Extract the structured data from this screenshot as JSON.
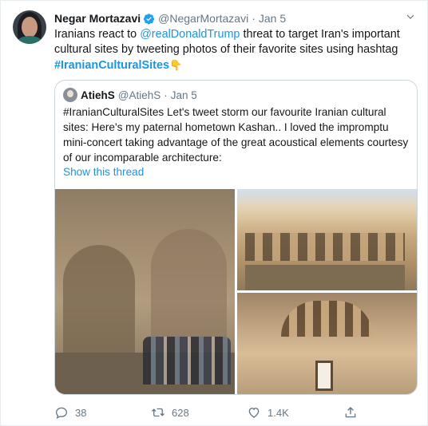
{
  "tweet": {
    "author_name": "Negar Mortazavi",
    "author_handle": "@NegarMortazavi",
    "separator": "·",
    "date": "Jan 5",
    "text_1": "Iranians react to ",
    "mention": "@realDonaldTrump",
    "text_2": " threat to target Iran's important cultural sites by tweeting photos of their favorite sites using hashtag ",
    "hashtag": "#IranianCulturalSites",
    "emoji": "👇"
  },
  "quote": {
    "author_name": "AtiehS",
    "author_handle": "@AtiehS",
    "separator": "·",
    "date": "Jan 5",
    "text": "#IranianCulturalSites Let's tweet storm our favourite Iranian cultural sites: Here's my paternal hometown Kashan.. I loved the impromptu mini-concert taking advantage of the great acoustical elements courtesy of our incomparable architecture:",
    "show_thread": "Show this thread"
  },
  "actions": {
    "reply_count": "38",
    "retweet_count": "628",
    "like_count": "1.4K"
  },
  "colors": {
    "link": "#1b95e0",
    "secondary_text": "#657786",
    "verified": "#1da1f2"
  }
}
